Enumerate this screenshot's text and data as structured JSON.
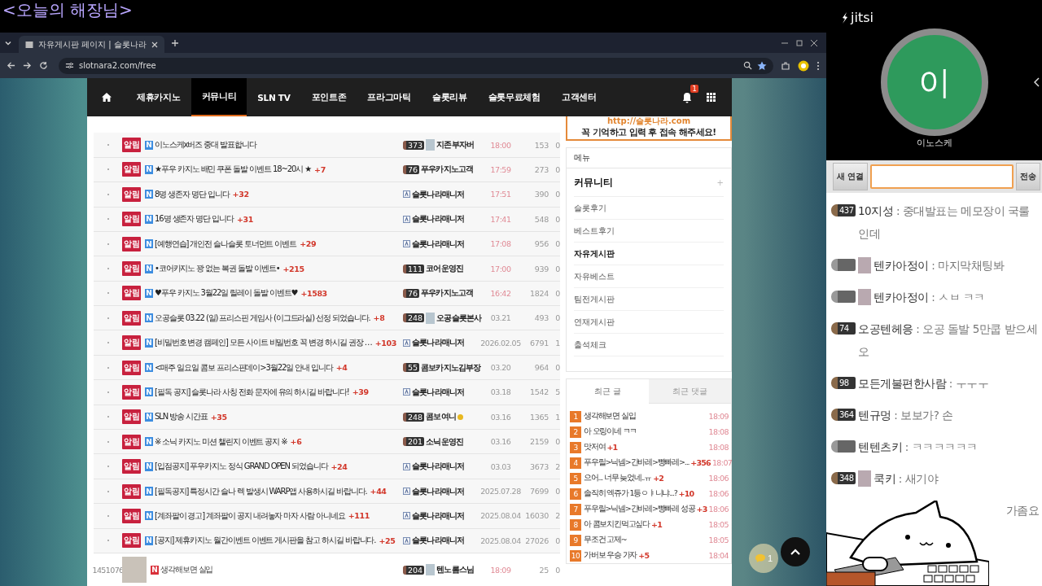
{
  "overlay_title": "<오늘의 해장님>",
  "browser": {
    "tab_title": "자유게시판 페이지 | 슬롯나라",
    "url": "slotnara2.com/free"
  },
  "nav": {
    "items": [
      {
        "label": "제휴카지노",
        "selected": false
      },
      {
        "label": "커뮤니티",
        "selected": true
      },
      {
        "label": "SLN TV",
        "selected": false
      },
      {
        "label": "포인트존",
        "selected": false
      },
      {
        "label": "프라그마틱",
        "selected": false
      },
      {
        "label": "슬롯리뷰",
        "selected": false
      },
      {
        "label": "슬롯무료체험",
        "selected": false
      },
      {
        "label": "고객센터",
        "selected": false
      }
    ],
    "notification_count": "1"
  },
  "board": {
    "rows": [
      {
        "kind": "notice",
        "badge": "알림",
        "new": "N",
        "title": "이노스케x버즈 중대 발표합니다",
        "author": {
          "name": "지존부자버",
          "level": "373",
          "avatar": true,
          "manager": false
        },
        "date": "18:00",
        "today": true,
        "views": "153",
        "likes": "0"
      },
      {
        "kind": "notice",
        "badge": "알림",
        "new": "N",
        "title": "★푸우 카지노 배민 쿠폰 돌발 이벤트 18~20시 ★",
        "comments": "+7",
        "author": {
          "name": "푸우카지노고객",
          "level": "76",
          "avatar": false,
          "manager": false
        },
        "date": "17:59",
        "today": true,
        "views": "273",
        "likes": "0"
      },
      {
        "kind": "notice",
        "badge": "알림",
        "new": "N",
        "title": "8명 생존자 명단 입니다",
        "comments": "+32",
        "author": {
          "name": "슬롯나라매니저",
          "avatar": false,
          "manager": true
        },
        "date": "17:51",
        "today": true,
        "views": "390",
        "likes": "0"
      },
      {
        "kind": "notice",
        "badge": "알림",
        "new": "N",
        "title": "16명 생존자 명단 입니다",
        "comments": "+31",
        "author": {
          "name": "슬롯나라매니저",
          "avatar": false,
          "manager": true
        },
        "date": "17:41",
        "today": true,
        "views": "548",
        "likes": "0"
      },
      {
        "kind": "notice",
        "badge": "알림",
        "new": "N",
        "title": "[예행연습] 개인전 슬나슬롯 토너먼트 이벤트",
        "comments": "+29",
        "author": {
          "name": "슬롯나라매니저",
          "avatar": false,
          "manager": true
        },
        "date": "17:08",
        "today": true,
        "views": "956",
        "likes": "0"
      },
      {
        "kind": "notice",
        "badge": "알림",
        "new": "N",
        "title": "•코어카지노 꽝 없는 복권 돌발 이벤트•",
        "comments": "+215",
        "author": {
          "name": "코어운영진",
          "level": "111",
          "avatar": false,
          "manager": false
        },
        "date": "17:00",
        "today": true,
        "views": "939",
        "likes": "0"
      },
      {
        "kind": "notice",
        "badge": "알림",
        "new": "N",
        "title": "♥푸우 카지노 3월22일 릴레이 돌발 이벤트♥",
        "comments": "+1583",
        "author": {
          "name": "푸우카지노고객",
          "level": "76",
          "avatar": false,
          "manager": false
        },
        "date": "16:42",
        "today": true,
        "views": "1824",
        "likes": "0"
      },
      {
        "kind": "notice",
        "badge": "알림",
        "new": "N",
        "title": "오공슬롯 03.22 (일) 프리스핀 게임사 (이그드라실) 선정 되었습니다.",
        "comments": "+8",
        "author": {
          "name": "오공슬롯본사",
          "level": "248",
          "avatar": true,
          "manager": false
        },
        "date": "03.21",
        "today": false,
        "views": "493",
        "likes": "0"
      },
      {
        "kind": "notice",
        "badge": "알림",
        "new": "N",
        "title": "[비밀번호 변경 캠페인] 모든 사이트 비밀번호 꼭 변경 하시길 권장 …",
        "comments": "+103",
        "author": {
          "name": "슬롯나라매니저",
          "avatar": false,
          "manager": true
        },
        "date": "2026.02.05",
        "today": false,
        "views": "6791",
        "likes": "1"
      },
      {
        "kind": "notice",
        "badge": "알림",
        "new": "N",
        "title": "<매주 일요일 콤보 프리스핀데이>3월22일 안내 입니다",
        "comments": "+4",
        "author": {
          "name": "콤보카지노김부장",
          "level": "55",
          "avatar": false,
          "manager": false
        },
        "date": "03.20",
        "today": false,
        "views": "964",
        "likes": "0"
      },
      {
        "kind": "notice",
        "badge": "알림",
        "new": "N",
        "title": "[필독 공지] 슬롯나라 사칭 전화 문자에 유의 하시길 바랍니다!",
        "comments": "+39",
        "author": {
          "name": "슬롯나라매니저",
          "avatar": false,
          "manager": true
        },
        "date": "03.18",
        "today": false,
        "views": "1542",
        "likes": "5"
      },
      {
        "kind": "notice",
        "badge": "알림",
        "new": "N",
        "title": "SLN 방송 시간표",
        "comments": "+35",
        "author": {
          "name": "콤보여니",
          "level": "248",
          "avatar": false,
          "manager": false,
          "coin": true
        },
        "date": "03.16",
        "today": false,
        "views": "1365",
        "likes": "1"
      },
      {
        "kind": "notice",
        "badge": "알림",
        "new": "N",
        "title": "※ 소닉 카지노 미션 챌린지 이벤트 공지 ※",
        "comments": "+6",
        "author": {
          "name": "소닉운영진",
          "level": "201",
          "avatar": false,
          "manager": false
        },
        "date": "03.16",
        "today": false,
        "views": "2159",
        "likes": "0"
      },
      {
        "kind": "notice",
        "badge": "알림",
        "new": "N",
        "title": "[입점공지] 푸우카지노 정식 GRAND OPEN 되었습니다",
        "comments": "+24",
        "author": {
          "name": "슬롯나라매니저",
          "avatar": false,
          "manager": true
        },
        "date": "03.03",
        "today": false,
        "views": "3673",
        "likes": "2"
      },
      {
        "kind": "notice",
        "badge": "알림",
        "new": "N",
        "title": "[필독공지] 특정시간 슬나 렉 발생시 WARP앱 사용하시길 바랍니다.",
        "comments": "+44",
        "author": {
          "name": "슬롯나라매니저",
          "avatar": false,
          "manager": true
        },
        "date": "2025.07.28",
        "today": false,
        "views": "7699",
        "likes": "0"
      },
      {
        "kind": "notice",
        "badge": "알림",
        "new": "N",
        "title": "[계좌팔이 경고] 계좌팔이 공지 내려놓자 마자 사람 아니네요",
        "comments": "+111",
        "author": {
          "name": "슬롯나라매니저",
          "avatar": false,
          "manager": true
        },
        "date": "2025.08.04",
        "today": false,
        "views": "16030",
        "likes": "2"
      },
      {
        "kind": "notice",
        "badge": "알림",
        "new": "N",
        "title": "[공지] 제휴카지노 월간이벤트 이벤트 게시판을 참고 하시길 바랍니다.",
        "comments": "+25",
        "author": {
          "name": "슬롯나라매니저",
          "avatar": false,
          "manager": true
        },
        "date": "2025.08.04",
        "today": false,
        "views": "27026",
        "likes": "0"
      },
      {
        "kind": "post",
        "number": "1451076",
        "thumbnail": true,
        "new": "N",
        "title": "생각해보면 실입",
        "author": {
          "name": "텐노롬스님",
          "level": "204",
          "avatar": true,
          "manager": false
        },
        "date": "18:09",
        "today": true,
        "views": "25",
        "likes": "0"
      }
    ]
  },
  "sidebar": {
    "banner": [
      "http://슬롯나라.com",
      "꼭 기억하고 입력 후 접속 해주세요!"
    ],
    "menu_label": "메뉴",
    "section": {
      "title": "커뮤니티",
      "toggle": "+"
    },
    "menu_items": [
      {
        "label": "슬롯후기",
        "selected": false
      },
      {
        "label": "베스트후기",
        "selected": false
      },
      {
        "label": "자유게시판",
        "selected": true
      },
      {
        "label": "자유베스트",
        "selected": false
      },
      {
        "label": "팀전게시판",
        "selected": false
      },
      {
        "label": "연재게시판",
        "selected": false
      },
      {
        "label": "출석체크",
        "selected": false
      }
    ],
    "recent_tabs": [
      {
        "label": "최근 글",
        "selected": true
      },
      {
        "label": "최근 댓글",
        "selected": false
      }
    ],
    "recent": [
      {
        "rank": "1",
        "title": "생각해보면 실입",
        "time": "18:09"
      },
      {
        "rank": "2",
        "title": "아 오링이네 ㅋㅋ",
        "time": "18:08"
      },
      {
        "rank": "3",
        "title": "맛저여",
        "comments": "+1",
        "time": "18:08"
      },
      {
        "rank": "4",
        "title": "푸우릴>닉넴>간바레>빵빠레>...",
        "comments": "+356",
        "time": "18:07"
      },
      {
        "rank": "5",
        "title": "으어... 너무 늦었네..ㅠ",
        "comments": "+2",
        "time": "18:06"
      },
      {
        "rank": "6",
        "title": "솔직히 엑쥬가 1등ㅇㅑ니냐...?",
        "comments": "+10",
        "time": "18:06"
      },
      {
        "rank": "7",
        "title": "푸우릴>닉넴>간바레>빵빠레 성공",
        "comments": "+3",
        "time": "18:06"
      },
      {
        "rank": "8",
        "title": "아 콤보치킨먹고싶다",
        "comments": "+1",
        "time": "18:05"
      },
      {
        "rank": "9",
        "title": "무조건 고제~",
        "time": "18:05"
      },
      {
        "rank": "10",
        "title": "가버보 우승 가자",
        "comments": "+5",
        "time": "18:04"
      }
    ]
  },
  "floating": {
    "chat_count": "1"
  },
  "call": {
    "logo": "jitsi",
    "avatar_initial": "이",
    "participant": "이노스케"
  },
  "chat": {
    "new_connection": "새 연결",
    "send": "전송",
    "messages": [
      {
        "kind": "chat",
        "level": "437",
        "avatar": false,
        "name": "10지성",
        "text": ": 중대발표는 메모장이 국룰인데"
      },
      {
        "kind": "chat",
        "avatar": true,
        "name": "텐카아정이",
        "text": ": 마지막채팅봐"
      },
      {
        "kind": "chat",
        "avatar": true,
        "name": "텐카아정이",
        "text": ": ㅅㅂ ㅋㅋ"
      },
      {
        "kind": "chat",
        "level": "74",
        "avatar": false,
        "name": "오공텐헤응",
        "text": ": 오공 돌발 5만쿱 받으세오"
      },
      {
        "kind": "chat",
        "level": "98",
        "avatar": false,
        "name": "모든게불편한사람",
        "text": ": ㅜㅜㅜ"
      },
      {
        "kind": "chat",
        "level": "364",
        "avatar": false,
        "name": "텐규멍",
        "text": ": 보보가? 손"
      },
      {
        "kind": "chat",
        "avatar": false,
        "name": "텐텐츠키",
        "text": ": ㅋㅋㅋㅋㅋㅋ"
      },
      {
        "kind": "chat",
        "level": "348",
        "avatar": true,
        "name": "쿡키",
        "text": ": 새기야"
      },
      {
        "kind": "covered",
        "text": "가좀요"
      }
    ]
  }
}
